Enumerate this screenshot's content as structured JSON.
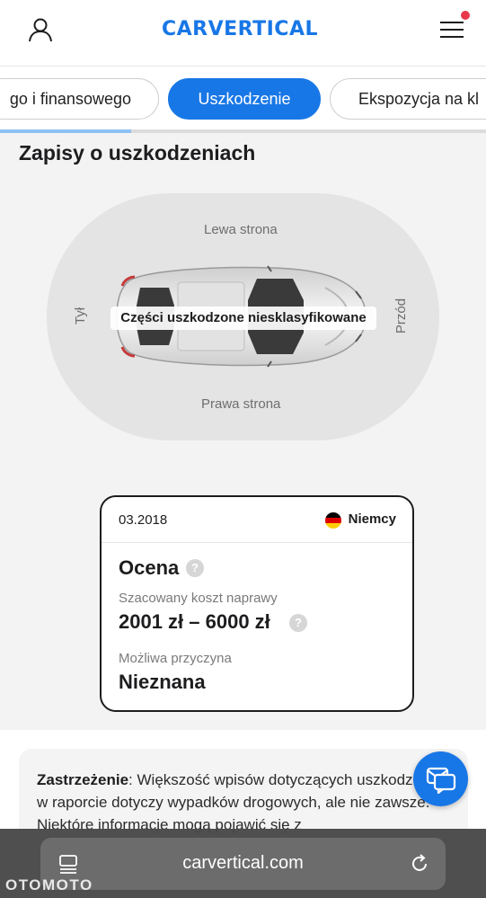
{
  "header": {
    "logo_text": "CARVERTICAL",
    "user_icon": "user-icon",
    "menu_icon": "hamburger-menu-icon",
    "notification_color": "#e8394a"
  },
  "tabs": {
    "items": [
      {
        "label": "go i finansowego",
        "active": false
      },
      {
        "label": "Uszkodzenie",
        "active": true
      },
      {
        "label": "Ekspozycja na kl",
        "active": false
      }
    ],
    "progress": 0.27
  },
  "section": {
    "title": "Zapisy o uszkodzeniach",
    "diagram": {
      "left_side": "Lewa strona",
      "right_side": "Prawa strona",
      "back": "Tył",
      "front": "Przód",
      "damage_label": "Części uszkodzone niesklasyfikowane"
    }
  },
  "record": {
    "date": "03.2018",
    "country": "Niemcy",
    "flag_colors": [
      "#000000",
      "#dd0000",
      "#ffce00"
    ],
    "heading": "Ocena",
    "cost_label": "Szacowany koszt naprawy",
    "cost_value": "2001 zł – 6000 zł",
    "cause_label": "Możliwa przyczyna",
    "cause_value": "Nieznana",
    "help_glyph": "?"
  },
  "disclaimer": {
    "bold": "Zastrzeżenie",
    "text": ": Większość wpisów dotyczących uszkodzeń w raporcie dotyczy wypadków drogowych, ale nie zawsze. Niektóre informacje mogą pojawić się z"
  },
  "browser": {
    "url": "carvertical.com",
    "tabs_icon": "tabs-icon",
    "reload_icon": "reload-icon"
  },
  "watermark": "OTOMOTO",
  "colors": {
    "accent": "#1877e6",
    "background": "#f3f3f3"
  }
}
